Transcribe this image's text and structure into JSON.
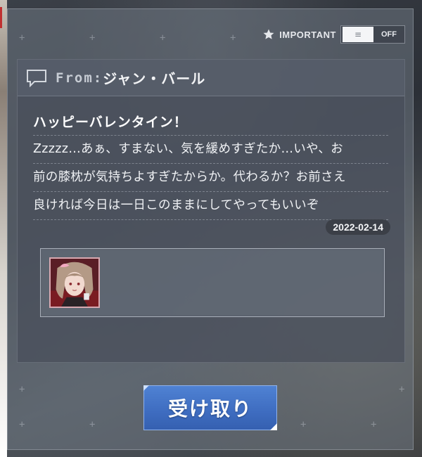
{
  "important_toggle": {
    "label": "IMPORTANT",
    "state_label": "OFF",
    "knob_glyph": "≡",
    "is_on": false
  },
  "message": {
    "from_label": "From:",
    "sender": "ジャン・バール",
    "title": "ハッピーバレンタイン！",
    "body_lines": [
      "Zzzzz…あぁ、すまない、気を緩めすぎたか…いや、お",
      "前の膝枕が気持ちよすぎたからか。代わるか？お前さえ",
      "良ければ今日は一日このままにしてやってもいいぞ"
    ],
    "date": "2022-02-14"
  },
  "attachment": {
    "items": [
      {
        "icon": "character-portrait-icon"
      }
    ]
  },
  "actions": {
    "receive_label": "受け取り"
  },
  "colors": {
    "button_blue": "#3e6cc0",
    "panel": "#6e7682",
    "text": "#f0f2f5"
  }
}
